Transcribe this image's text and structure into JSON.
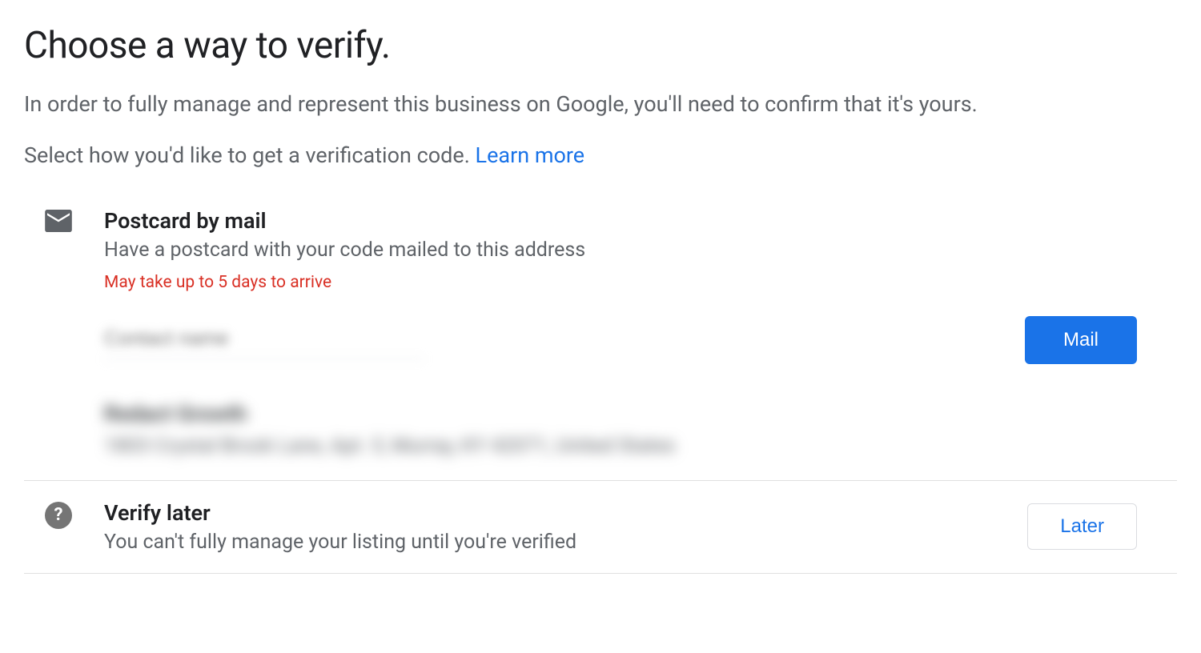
{
  "header": {
    "title": "Choose a way to verify.",
    "subtitle": "In order to fully manage and represent this business on Google, you'll need to confirm that it's yours.",
    "instruction": "Select how you'd like to get a verification code. ",
    "learn_more": "Learn more"
  },
  "postcard": {
    "title": "Postcard by mail",
    "description": "Have a postcard with your code mailed to this address",
    "warning": "May take up to 5 days to arrive",
    "contact_placeholder": "Contact name",
    "button_label": "Mail",
    "business_name_redacted": "Redact Growth",
    "address_redacted": "1803 Crystal Brook Lane, Apt. 5, Murray, KY 42071, United States"
  },
  "later": {
    "title": "Verify later",
    "description": "You can't fully manage your listing until you're verified",
    "button_label": "Later"
  }
}
